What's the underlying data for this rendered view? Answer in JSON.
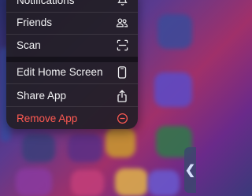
{
  "menu": {
    "items": [
      {
        "label": "Notifications",
        "icon": "bell-icon"
      },
      {
        "label": "Friends",
        "icon": "people-icon"
      },
      {
        "label": "Scan",
        "icon": "scan-icon"
      },
      {
        "label": "Edit Home Screen",
        "icon": "phone-icon"
      },
      {
        "label": "Share App",
        "icon": "share-icon"
      },
      {
        "label": "Remove App",
        "icon": "minus-circle-icon"
      }
    ],
    "remove_color": "#ff5a52"
  },
  "side_handle": {
    "glyph": "❮"
  }
}
